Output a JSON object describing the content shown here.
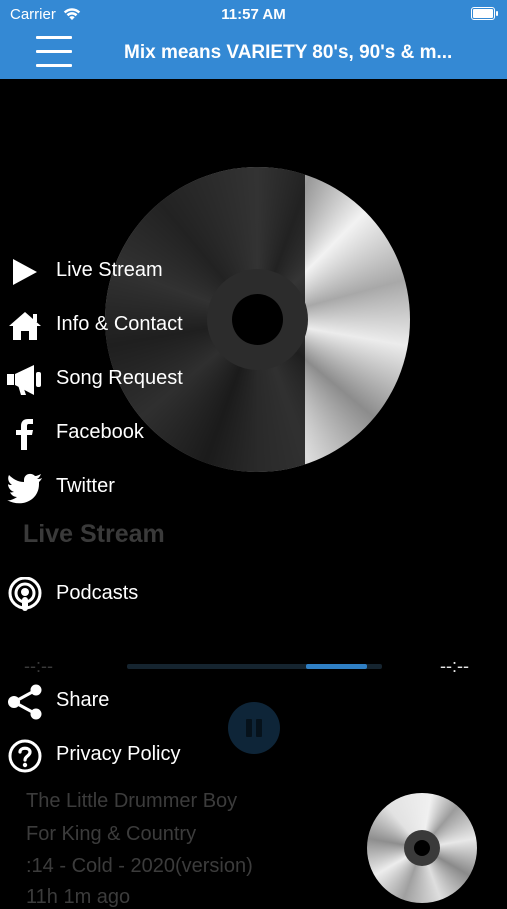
{
  "status_bar": {
    "carrier": "Carrier",
    "time": "11:57 AM"
  },
  "header": {
    "title": "Mix means VARIETY 80's, 90's & m..."
  },
  "menu": {
    "items": [
      {
        "label": "Live Stream",
        "icon": "play-icon"
      },
      {
        "label": "Info & Contact",
        "icon": "home-icon"
      },
      {
        "label": "Song Request",
        "icon": "megaphone-icon"
      },
      {
        "label": "Facebook",
        "icon": "facebook-icon"
      },
      {
        "label": "Twitter",
        "icon": "twitter-icon"
      },
      {
        "label": "Podcasts",
        "icon": "podcast-icon"
      },
      {
        "label": "Share",
        "icon": "share-icon"
      },
      {
        "label": "Privacy Policy",
        "icon": "question-icon"
      }
    ]
  },
  "player": {
    "section_title": "Live Stream",
    "elapsed": "--:--",
    "remaining": "--:--",
    "progress_fraction": 0.24,
    "progress_start_fraction": 0.7,
    "now_playing": {
      "title": "The Little Drummer Boy",
      "artist": "For King & Country",
      "album": ":14 - Cold - 2020(version)",
      "time_ago": "11h 1m ago"
    }
  },
  "colors": {
    "accent": "#3489d4",
    "progress": "#2f7fc4"
  }
}
